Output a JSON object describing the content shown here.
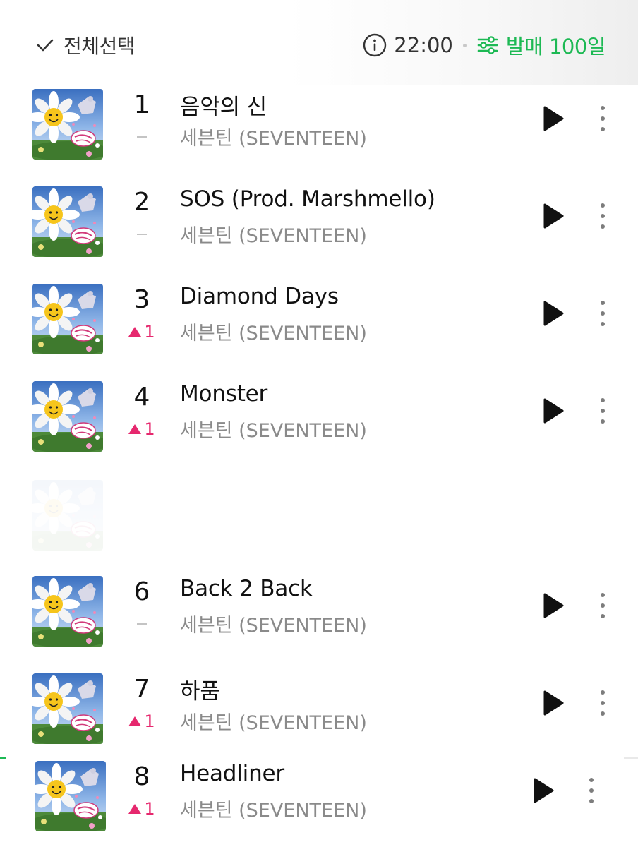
{
  "header": {
    "select_all_label": "전체선택",
    "time": "22:00",
    "filter_label": "발매 100일",
    "accent_color": "#1db954",
    "icons": [
      "check-icon",
      "info-icon",
      "filter-sliders-icon"
    ]
  },
  "tracks": [
    {
      "rank": "1",
      "change": "-",
      "change_type": "same",
      "title": "음악의 신",
      "artist": "세븐틴 (SEVENTEEN)"
    },
    {
      "rank": "2",
      "change": "-",
      "change_type": "same",
      "title": "SOS (Prod. Marshmello)",
      "artist": "세븐틴 (SEVENTEEN)"
    },
    {
      "rank": "3",
      "change": "1",
      "change_type": "up",
      "title": "Diamond Days",
      "artist": "세븐틴 (SEVENTEEN)"
    },
    {
      "rank": "4",
      "change": "1",
      "change_type": "up",
      "title": "Monster",
      "artist": "세븐틴 (SEVENTEEN)"
    },
    {
      "rank": "6",
      "change": "-",
      "change_type": "same",
      "title": "Back 2 Back",
      "artist": "세븐틴 (SEVENTEEN)"
    },
    {
      "rank": "7",
      "change": "1",
      "change_type": "up",
      "title": "하품",
      "artist": "세븐틴 (SEVENTEEN)"
    },
    {
      "rank": "8",
      "change": "1",
      "change_type": "up",
      "title": "Headliner",
      "artist": "세븐틴 (SEVENTEEN)"
    }
  ],
  "colors": {
    "rank_up": "#e6286e",
    "rank_same": "#c4c4c4",
    "artist_text": "#8a8a8a"
  },
  "row_icons": [
    "album-cover",
    "play-icon",
    "more-vertical-icon"
  ]
}
